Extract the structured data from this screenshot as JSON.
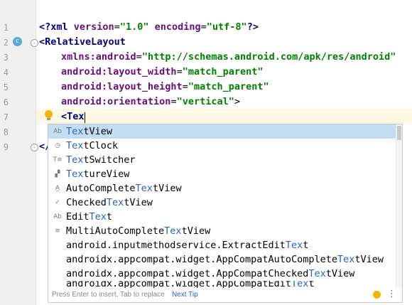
{
  "editor": {
    "line_numbers": [
      "1",
      "2",
      "3",
      "4",
      "5",
      "6",
      "7",
      "8",
      "9"
    ],
    "lines": {
      "l1": {
        "a": "<?xml ",
        "b": "version",
        "c": "=",
        "d": "\"1.0\"",
        "e": " ",
        "f": "encoding",
        "g": "=",
        "h": "\"utf-8\"",
        "i": "?>"
      },
      "l2": {
        "a": "<",
        "b": "RelativeLayout"
      },
      "l3": {
        "a": "xmlns:android",
        "b": "=",
        "c": "\"http://schemas.android.com/apk/res/android\""
      },
      "l4": {
        "a": "android:layout_width",
        "b": "=",
        "c": "\"match_parent\""
      },
      "l5": {
        "a": "android:layout_height",
        "b": "=",
        "c": "\"match_parent\""
      },
      "l6": {
        "a": "android:orientation",
        "b": "=",
        "c": "\"vertical\"",
        "d": ">"
      },
      "l7": {
        "a": "<",
        "b": "Tex"
      },
      "l9": {
        "a": "</"
      }
    },
    "class_badge": "c",
    "fold_markers": [
      "-",
      "-"
    ]
  },
  "autocomplete": {
    "items": [
      {
        "icon": "Ab",
        "pre": "",
        "match": "Tex",
        "post": "tView"
      },
      {
        "icon": "◷",
        "pre": "",
        "match": "Tex",
        "post": "tClock"
      },
      {
        "icon": "T≡",
        "pre": "",
        "match": "Tex",
        "post": "tSwitcher"
      },
      {
        "icon": "▞",
        "pre": "",
        "match": "Tex",
        "post": "tureView"
      },
      {
        "icon": "A̲",
        "pre": "AutoComplete",
        "match": "Tex",
        "post": "tView"
      },
      {
        "icon": "✓",
        "pre": "Checked",
        "match": "Tex",
        "post": "tView"
      },
      {
        "icon": "Ab",
        "pre": "Edit",
        "match": "Tex",
        "post": "t"
      },
      {
        "icon": "≡",
        "pre": "MultiAutoComplete",
        "match": "Tex",
        "post": "tView"
      },
      {
        "icon": "",
        "pre": "android.inputmethodservice.ExtractEdit",
        "match": "Tex",
        "post": "t"
      },
      {
        "icon": "",
        "pre": "androidx.appcompat.widget.AppCompatAutoComplete",
        "match": "Tex",
        "post": "tView"
      },
      {
        "icon": "",
        "pre": "androidx.appcompat.widget.AppCompatChecked",
        "match": "Tex",
        "post": "tView"
      },
      {
        "icon": "",
        "pre": "androidx.appcompat.widget.AppCompatEdit",
        "match": "Tex",
        "post": "t"
      }
    ],
    "footer_hint": "Press Enter to insert, Tab to replace",
    "footer_link": "Next Tip",
    "footer_more": "⋮"
  },
  "colors": {
    "tag": "#000080",
    "attribute": "#660e7a",
    "value": "#008000",
    "selection": "#c5dcf5",
    "match_highlight": "#2a5fc7",
    "caret_line": "#fbf9e2"
  }
}
